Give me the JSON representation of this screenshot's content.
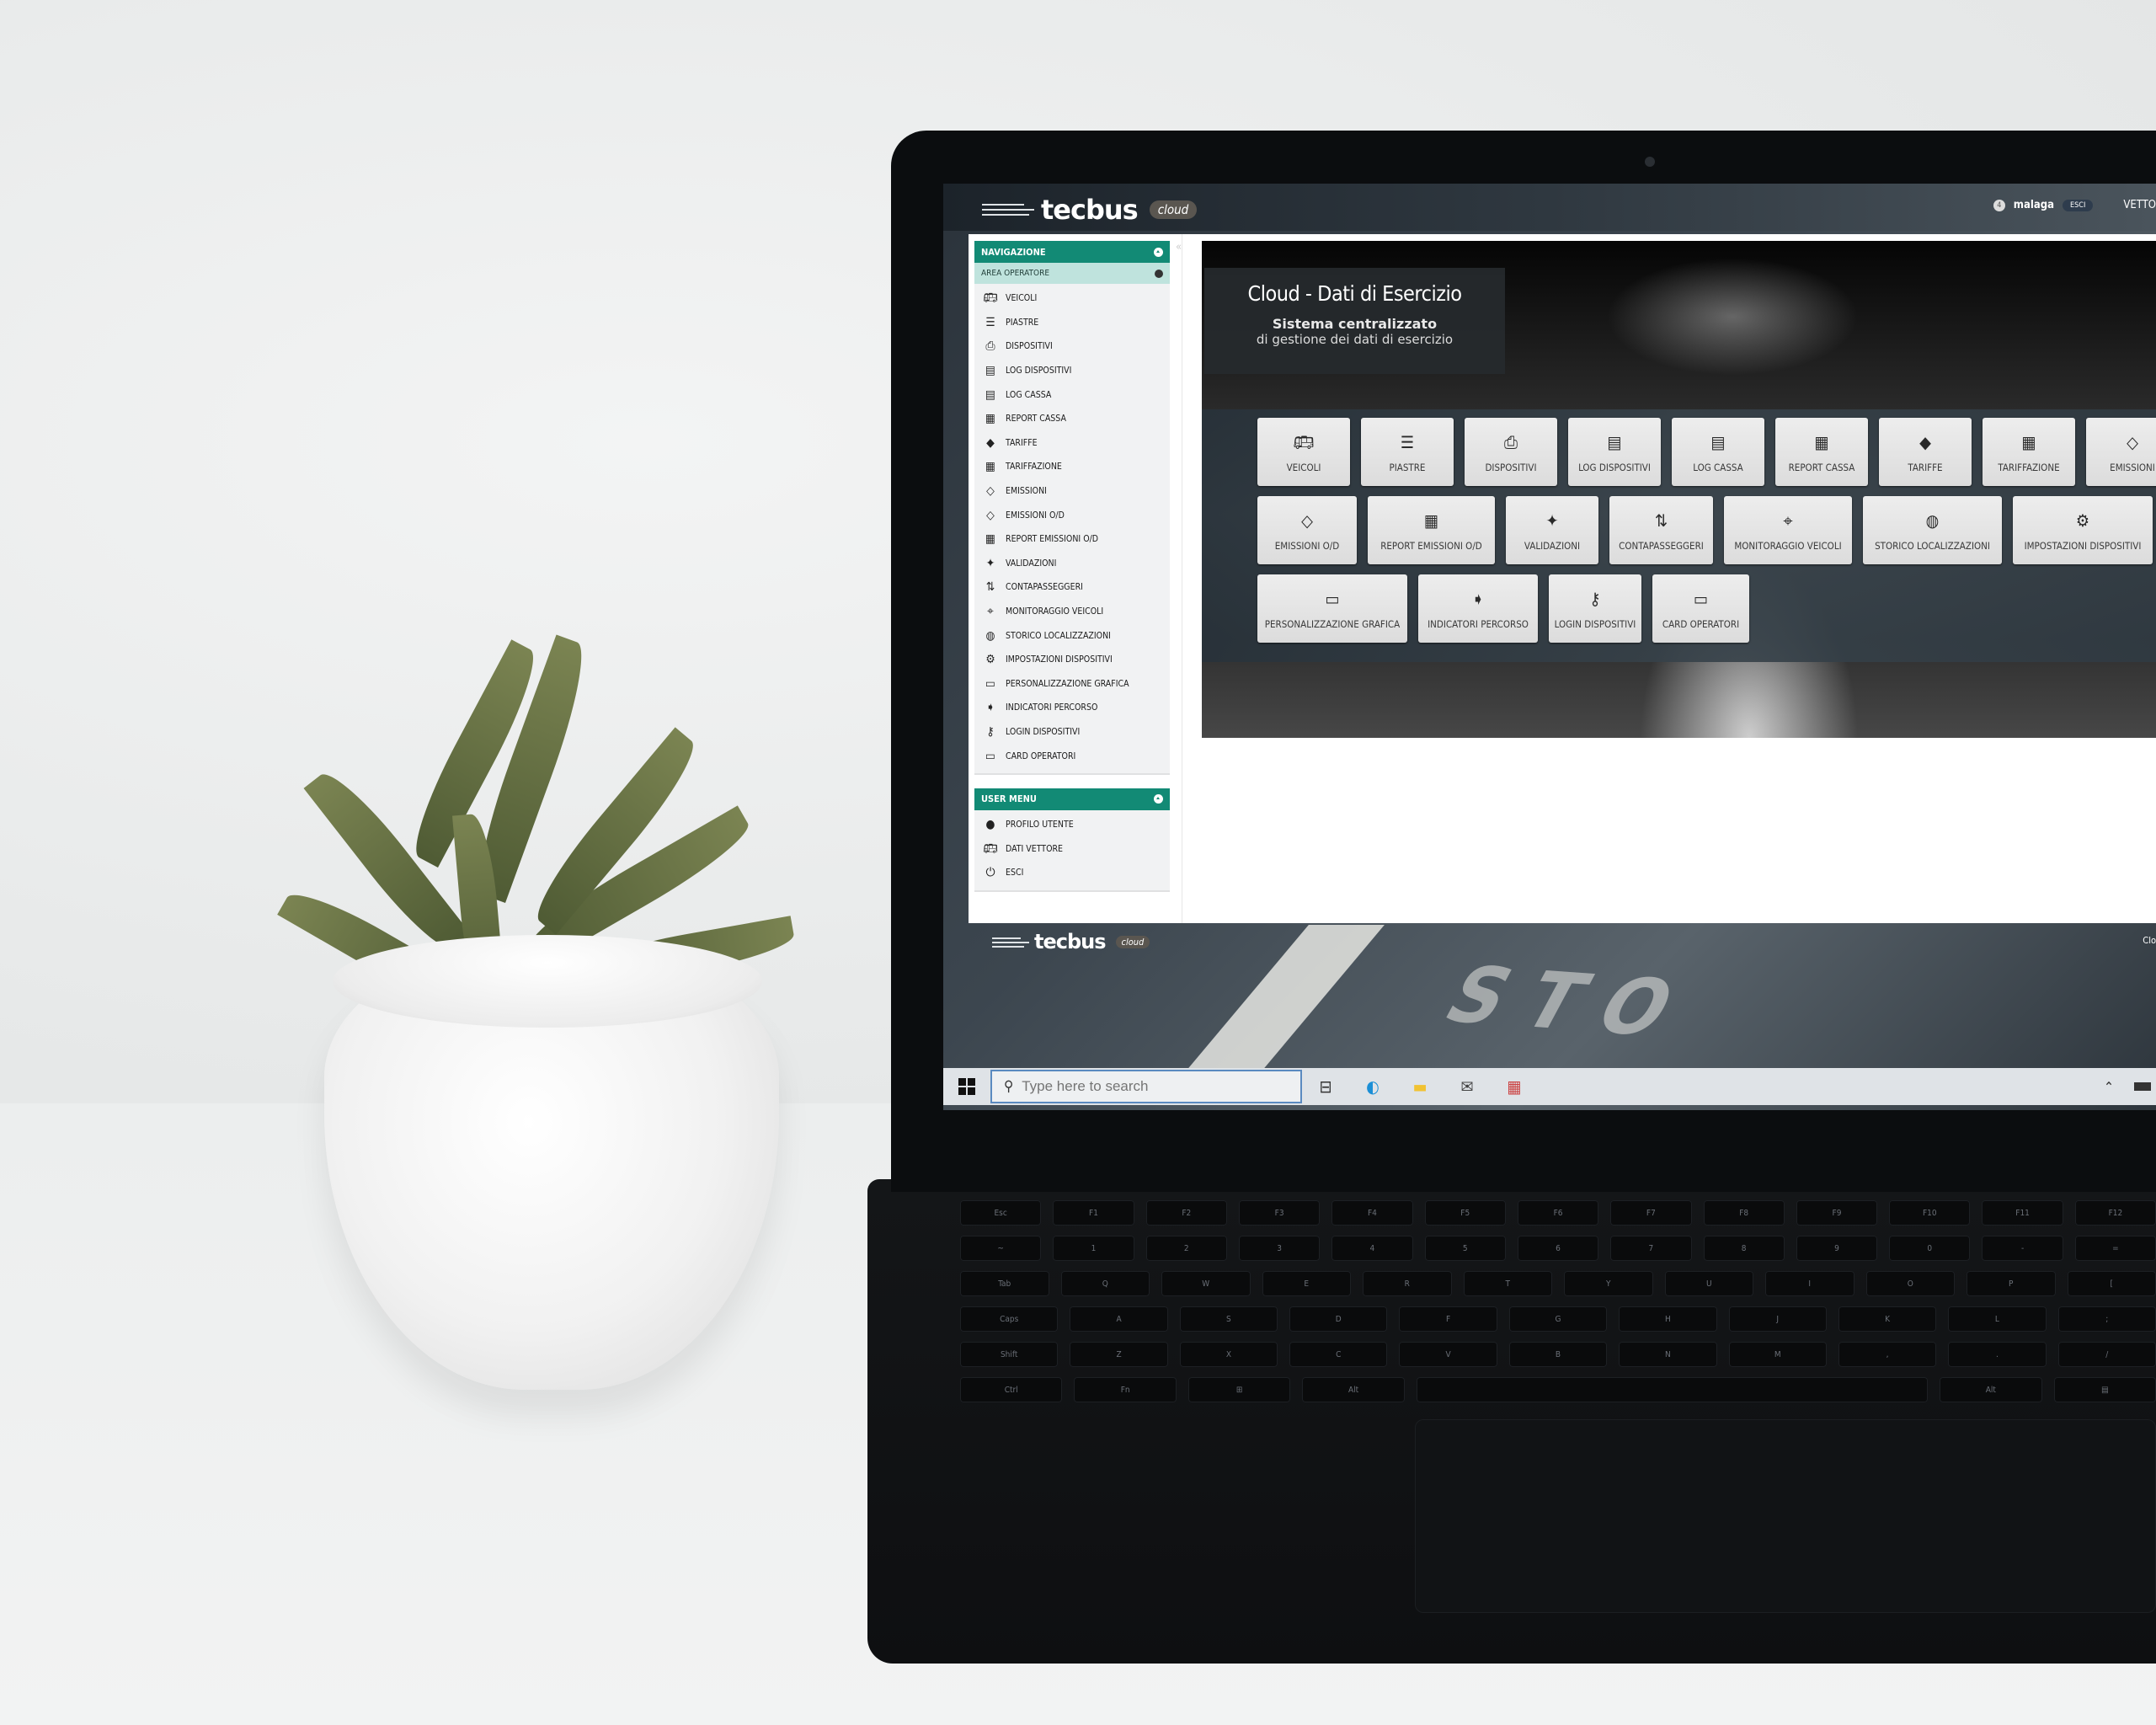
{
  "app": {
    "brand": "tecbus",
    "brand_suffix": "cloud",
    "user": {
      "badge": "4",
      "name": "malaga",
      "logout_label": "ESCI",
      "vettore_label": "VETTO"
    }
  },
  "sidebar": {
    "nav_header": "NAVIGAZIONE",
    "area_header": "AREA OPERATORE",
    "items": [
      {
        "label": "VEICOLI",
        "icon": "bus-icon"
      },
      {
        "label": "PIASTRE",
        "icon": "server-stack-icon"
      },
      {
        "label": "DISPOSITIVI",
        "icon": "printer-icon"
      },
      {
        "label": "LOG DISPOSITIVI",
        "icon": "checklist-icon"
      },
      {
        "label": "LOG CASSA",
        "icon": "checklist-icon"
      },
      {
        "label": "REPORT CASSA",
        "icon": "calendar-clock-icon"
      },
      {
        "label": "TARIFFE",
        "icon": "price-tag-icon"
      },
      {
        "label": "TARIFFAZIONE",
        "icon": "grid-icon"
      },
      {
        "label": "EMISSIONI",
        "icon": "ticket-outline-icon"
      },
      {
        "label": "EMISSIONI O/D",
        "icon": "ticket-outline-icon"
      },
      {
        "label": "REPORT EMISSIONI O/D",
        "icon": "calendar-clock-icon"
      },
      {
        "label": "VALIDAZIONI",
        "icon": "ticket-star-icon"
      },
      {
        "label": "CONTAPASSEGGERI",
        "icon": "swap-arrows-icon"
      },
      {
        "label": "MONITORAGGIO VEICOLI",
        "icon": "map-pin-icon"
      },
      {
        "label": "STORICO LOCALIZZAZIONI",
        "icon": "globe-pin-icon"
      },
      {
        "label": "IMPOSTAZIONI DISPOSITIVI",
        "icon": "gear-icon"
      },
      {
        "label": "PERSONALIZZAZIONE GRAFICA",
        "icon": "monitor-icon"
      },
      {
        "label": "INDICATORI PERCORSO",
        "icon": "signpost-icon"
      },
      {
        "label": "LOGIN DISPOSITIVI",
        "icon": "key-icon"
      },
      {
        "label": "CARD OPERATORI",
        "icon": "card-hand-icon"
      }
    ],
    "user_menu_header": "USER MENU",
    "user_items": [
      {
        "label": "PROFILO UTENTE",
        "icon": "user-icon"
      },
      {
        "label": "DATI VETTORE",
        "icon": "bus-icon"
      },
      {
        "label": "ESCI",
        "icon": "power-icon"
      }
    ]
  },
  "hero": {
    "title": "Cloud - Dati di Esercizio",
    "subtitle_bold": "Sistema centralizzato",
    "subtitle": "di gestione dei dati di esercizio"
  },
  "tiles": {
    "row1": [
      {
        "label": "VEICOLI",
        "icon": "bus-icon"
      },
      {
        "label": "PIASTRE",
        "icon": "server-stack-icon"
      },
      {
        "label": "DISPOSITIVI",
        "icon": "printer-icon"
      },
      {
        "label": "LOG DISPOSITIVI",
        "icon": "checklist-icon"
      },
      {
        "label": "LOG CASSA",
        "icon": "checklist-icon"
      },
      {
        "label": "REPORT CASSA",
        "icon": "calendar-clock-icon"
      },
      {
        "label": "TARIFFE",
        "icon": "price-tag-icon"
      },
      {
        "label": "TARIFFAZIONE",
        "icon": "grid-icon"
      },
      {
        "label": "EMISSIONI",
        "icon": "ticket-outline-icon"
      }
    ],
    "row2": [
      {
        "label": "EMISSIONI O/D",
        "icon": "ticket-outline-icon"
      },
      {
        "label": "REPORT EMISSIONI O/D",
        "icon": "calendar-clock-icon"
      },
      {
        "label": "VALIDAZIONI",
        "icon": "ticket-star-icon"
      },
      {
        "label": "CONTAPASSEGGERI",
        "icon": "swap-arrows-icon"
      },
      {
        "label": "MONITORAGGIO VEICOLI",
        "icon": "map-pin-icon"
      },
      {
        "label": "STORICO LOCALIZZAZIONI",
        "icon": "globe-pin-icon"
      },
      {
        "label": "IMPOSTAZIONI DISPOSITIVI",
        "icon": "gear-icon"
      }
    ],
    "row3": [
      {
        "label": "PERSONALIZZAZIONE GRAFICA",
        "icon": "monitor-icon"
      },
      {
        "label": "INDICATORI PERCORSO",
        "icon": "signpost-icon"
      },
      {
        "label": "LOGIN DISPOSITIVI",
        "icon": "key-icon"
      },
      {
        "label": "CARD OPERATORI",
        "icon": "card-hand-icon"
      }
    ]
  },
  "footer": {
    "brand": "tecbus",
    "brand_suffix": "cloud",
    "right_text": "Clo"
  },
  "taskbar": {
    "search_placeholder": "Type here to search",
    "apps": [
      "task-view-icon",
      "edge-icon",
      "file-explorer-icon",
      "mail-icon",
      "store-icon"
    ]
  },
  "colors": {
    "accent_teal": "#128a75",
    "accent_teal_light": "#bfe3dd",
    "tile_bg": "#e4e4e4"
  }
}
